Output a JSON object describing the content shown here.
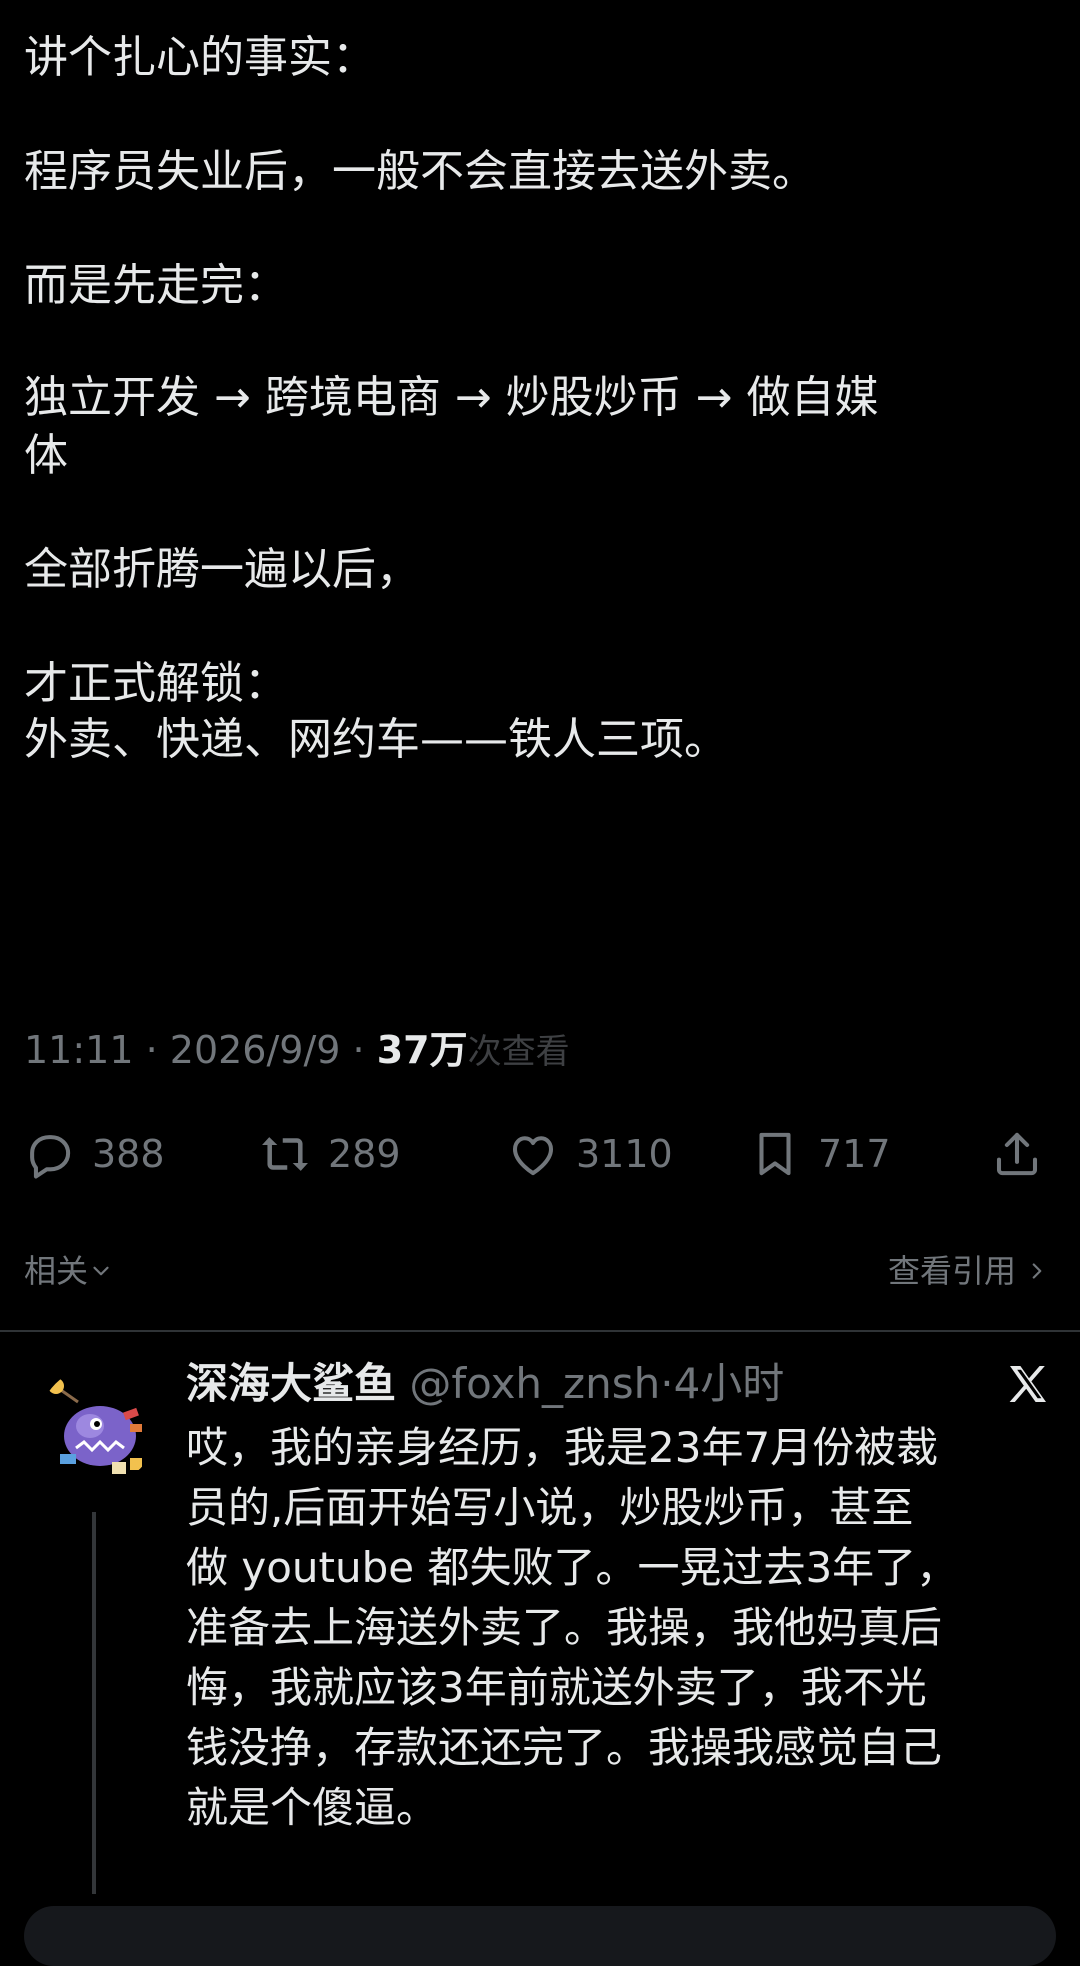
{
  "post": {
    "lines": [
      "讲个扎心的事实：",
      "程序员失业后，一般不会直接去送外卖。",
      "而是先走完：",
      "独立开发 → 跨境电商 → 炒股炒币 → 做自媒",
      "体",
      "全部折腾一遍以后，",
      "才正式解锁：",
      "外卖、快递、网约车——铁人三项。"
    ],
    "time": "11:11",
    "date": "2026/9/9",
    "views": "37万",
    "views_label": "次查看"
  },
  "actions": {
    "replies": "388",
    "reposts": "289",
    "likes": "3110",
    "bookmarks": "717"
  },
  "related": {
    "left_label": "相关",
    "right_label": "查看引用"
  },
  "reply": {
    "name": "深海大鲨鱼",
    "handle": "@foxh_znsh",
    "time": "4小时",
    "lines": [
      "哎，我的亲身经历，我是23年7月份被裁",
      "员的,后面开始写小说，炒股炒币，甚至",
      "做 youtube 都失败了。一晃过去3年了，",
      "准备去上海送外卖了。我操，我他妈真后",
      "悔，我就应该3年前就送外卖了，我不光",
      "钱没挣，存款还还完了。我操我感觉自己",
      "就是个傻逼。"
    ]
  },
  "colors": {
    "background": "#000000",
    "text": "#e7e9ea",
    "muted": "#71767b",
    "divider": "#2f3336"
  },
  "icons": [
    "reply-icon",
    "repost-icon",
    "like-icon",
    "bookmark-icon",
    "share-icon",
    "chevron-down-icon",
    "chevron-right-icon",
    "x-logo-icon"
  ]
}
